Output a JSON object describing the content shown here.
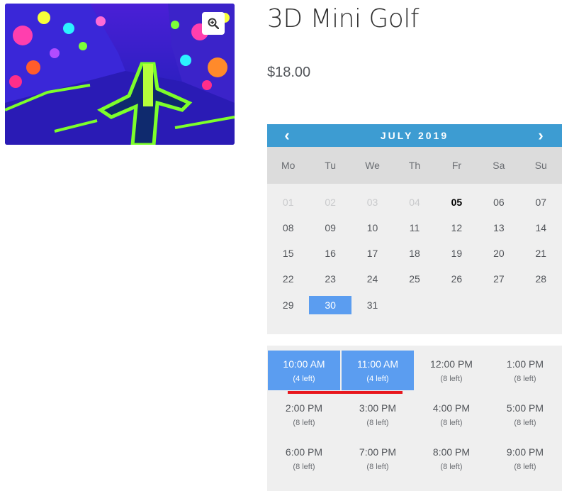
{
  "product": {
    "title": "3D Mini Golf",
    "price": "$18.00",
    "zoom_icon": "zoom-in-icon"
  },
  "calendar": {
    "month_label": "JULY 2019",
    "prev_label": "‹",
    "next_label": "›",
    "weekdays": [
      "Mo",
      "Tu",
      "We",
      "Th",
      "Fr",
      "Sa",
      "Su"
    ],
    "weeks": [
      [
        "01",
        "02",
        "03",
        "04",
        "05",
        "06",
        "07"
      ],
      [
        "08",
        "09",
        "10",
        "11",
        "12",
        "13",
        "14"
      ],
      [
        "15",
        "16",
        "17",
        "18",
        "19",
        "20",
        "21"
      ],
      [
        "22",
        "23",
        "24",
        "25",
        "26",
        "27",
        "28"
      ],
      [
        "29",
        "30",
        "31",
        "",
        "",
        "",
        ""
      ]
    ],
    "past_days": [
      "01",
      "02",
      "03",
      "04"
    ],
    "today": "05",
    "selected_day": "30"
  },
  "time_slots": [
    {
      "time": "10:00 AM",
      "left": "(4 left)",
      "selected": true
    },
    {
      "time": "11:00 AM",
      "left": "(4 left)",
      "selected": true
    },
    {
      "time": "12:00 PM",
      "left": "(8 left)",
      "selected": false
    },
    {
      "time": "1:00 PM",
      "left": "(8 left)",
      "selected": false
    },
    {
      "time": "2:00 PM",
      "left": "(8 left)",
      "selected": false
    },
    {
      "time": "3:00 PM",
      "left": "(8 left)",
      "selected": false
    },
    {
      "time": "4:00 PM",
      "left": "(8 left)",
      "selected": false
    },
    {
      "time": "5:00 PM",
      "left": "(8 left)",
      "selected": false
    },
    {
      "time": "6:00 PM",
      "left": "(8 left)",
      "selected": false
    },
    {
      "time": "7:00 PM",
      "left": "(8 left)",
      "selected": false
    },
    {
      "time": "8:00 PM",
      "left": "(8 left)",
      "selected": false
    },
    {
      "time": "9:00 PM",
      "left": "(8 left)",
      "selected": false
    }
  ],
  "colors": {
    "header_blue": "#3d9cd2",
    "selected_blue": "#5b9df0",
    "annotation_red": "#e8171d"
  }
}
